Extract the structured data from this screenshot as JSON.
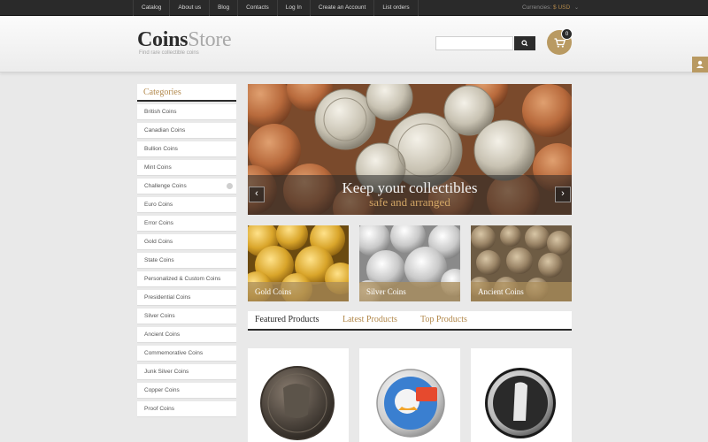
{
  "topnav": {
    "items": [
      "Catalog",
      "About us",
      "Blog",
      "Contacts",
      "Log In",
      "Create an Account",
      "List orders"
    ]
  },
  "currency": {
    "label": "Currencies:",
    "value": "$ USD"
  },
  "header": {
    "logo_bold": "Coins",
    "logo_light": "Store",
    "tagline": "Find rare collectible coins",
    "cart_count": "0"
  },
  "colors": {
    "accent": "#b2884b",
    "dark": "#2b2b2b",
    "cart": "#b99a62"
  },
  "sidebar": {
    "title": "Categories",
    "items": [
      "British Coins",
      "Canadian Coins",
      "Bullion Coins",
      "Mint Coins",
      "Challenge Coins",
      "Euro Coins",
      "Error Coins",
      "Gold Coins",
      "State Coins",
      "Personalized & Custom Coins",
      "Presidential Coins",
      "Silver Coins",
      "Ancient Coins",
      "Commemorative Coins",
      "Junk Silver Coins",
      "Copper Coins",
      "Proof Coins"
    ]
  },
  "slider": {
    "headline": "Keep your collectibles",
    "subline": "safe and arranged"
  },
  "banners": [
    "Gold Coins",
    "Silver Coins",
    "Ancient Coins"
  ],
  "tabs": [
    "Featured Products",
    "Latest Products",
    "Top Products"
  ],
  "icons": {
    "search": "search-icon",
    "cart": "cart-icon",
    "prev": "chevron-left-icon",
    "next": "chevron-right-icon",
    "expand": "plus-circle-icon"
  }
}
